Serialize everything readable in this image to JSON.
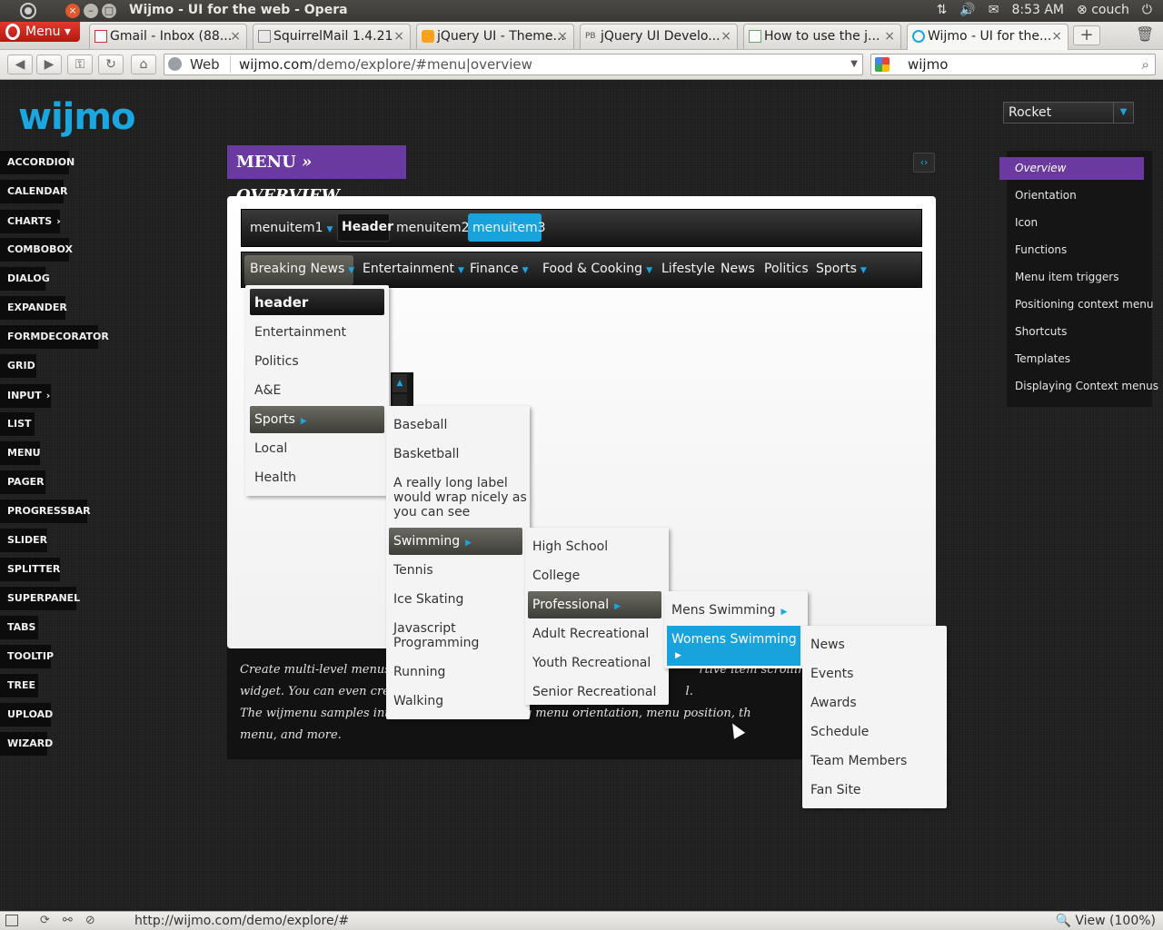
{
  "os": {
    "window_title": "Wijmo - UI for the web - Opera",
    "time": "8:53 AM",
    "user": "couch"
  },
  "browser": {
    "menu_label": "Menu",
    "tabs": [
      {
        "label": "Gmail - Inbox (88...",
        "icon": "gmail-icon"
      },
      {
        "label": "SquirrelMail 1.4.21",
        "icon": "page-icon"
      },
      {
        "label": "jQuery UI - Theme...",
        "icon": "jquery-icon"
      },
      {
        "label": "jQuery UI Develo...",
        "icon": "pb-icon"
      },
      {
        "label": "How to use the j...",
        "icon": "doc-icon"
      },
      {
        "label": "Wijmo - UI for the...",
        "icon": "opera-icon"
      }
    ],
    "address": {
      "web_label": "Web",
      "host": "wijmo.com",
      "path": "/demo/explore/#menu|overview"
    },
    "search_value": "wijmo",
    "status_url": "http://wijmo.com/demo/explore/#",
    "zoom": "View (100%)"
  },
  "page": {
    "logo": "wijmo",
    "theme": "Rocket",
    "title_a": "MENU",
    "title_sep": " » ",
    "title_b": "OVERVIEW",
    "left_nav": [
      "ACCORDION",
      "CALENDAR",
      "CHARTS",
      "COMBOBOX",
      "DIALOG",
      "EXPANDER",
      "FORMDECORATOR",
      "GRID",
      "INPUT",
      "LIST",
      "MENU",
      "PAGER",
      "PROGRESSBAR",
      "SLIDER",
      "SPLITTER",
      "SUPERPANEL",
      "TABS",
      "TOOLTIP",
      "TREE",
      "UPLOAD",
      "WIZARD"
    ],
    "right_nav": [
      "Overview",
      "Orientation",
      "Icon",
      "Functions",
      "Menu item triggers",
      "Positioning context menu",
      "Shortcuts",
      "Templates",
      "Displaying Context menus"
    ],
    "menubar1": {
      "item1": "menuitem1",
      "header": "Header",
      "item2": "menuitem2",
      "item3": "menuitem3"
    },
    "menubar2": [
      "Breaking News",
      "Entertainment",
      "Finance",
      "Food & Cooking",
      "Lifestyle",
      "News",
      "Politics",
      "Sports"
    ],
    "dropdown1": {
      "header": "header",
      "items": [
        "Entertainment",
        "Politics",
        "A&E",
        "Sports",
        "Local",
        "Health"
      ]
    },
    "dropdown2": {
      "items": [
        "Baseball",
        "Basketball",
        "A really long label",
        "would wrap nicely as",
        "you can see",
        "Swimming",
        "Tennis",
        "Ice Skating",
        "Javascript",
        "Programming",
        "Running",
        "Walking"
      ]
    },
    "dropdown3": {
      "items": [
        "High School",
        "College",
        "Professional",
        "Adult Recreational",
        "Youth Recreational",
        "Senior Recreational"
      ]
    },
    "dropdown4": {
      "items": [
        "Mens Swimming",
        "Womens Swimming"
      ]
    },
    "dropdown5": {
      "items": [
        "News",
        "Events",
        "Awards",
        "Schedule",
        "Team Members",
        "Fan Site"
      ]
    },
    "description": {
      "line1_a": "Create multi-level menus wi",
      "line1_b": "rtive item scrolling, and m",
      "line2_a": "widget. You can even create",
      "line2_b": "l.",
      "line3_a": "The wijmenu samples introd",
      "line3_b": "features, including menu orientation, menu position, th",
      "line4": "menu, and more."
    }
  },
  "colors": {
    "accent": "#1aa6df",
    "purple": "#6a3aa0",
    "highlight_blue": "#19a3dc"
  }
}
